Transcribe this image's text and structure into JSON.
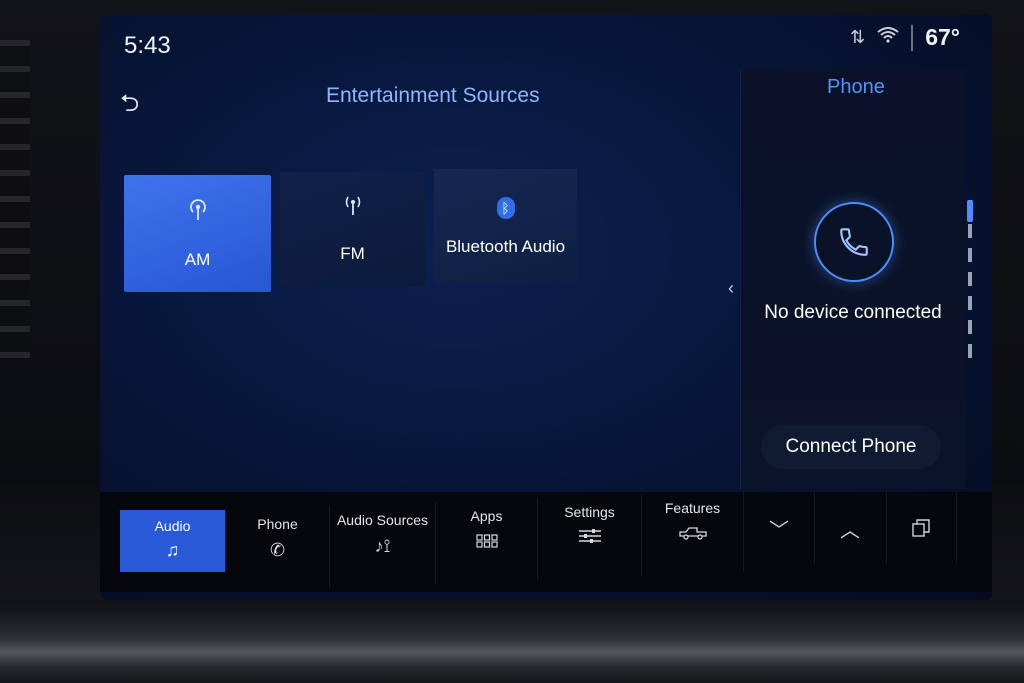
{
  "status": {
    "time": "5:43",
    "temperature": "67°",
    "signal_icon": "signal-arrows-icon",
    "wifi_icon": "wifi-icon"
  },
  "header": {
    "title": "Entertainment Sources",
    "back_icon": "back-arrow-icon"
  },
  "sources": [
    {
      "label": "AM",
      "icon": "am-antenna-icon",
      "active": true
    },
    {
      "label": "FM",
      "icon": "fm-antenna-icon",
      "active": false
    },
    {
      "label": "Bluetooth Audio",
      "icon": "bluetooth-icon",
      "active": false
    }
  ],
  "phone_panel": {
    "title": "Phone",
    "status": "No device connected",
    "connect_label": "Connect Phone"
  },
  "nav": {
    "items": [
      {
        "label": "Audio",
        "icon": "music-note-icon"
      },
      {
        "label": "Phone",
        "icon": "phone-icon"
      },
      {
        "label": "Audio Sources",
        "icon": "audio-sources-icon"
      },
      {
        "label": "Apps",
        "icon": "apps-grid-icon"
      },
      {
        "label": "Settings",
        "icon": "sliders-icon"
      },
      {
        "label": "Features",
        "icon": "truck-icon"
      }
    ]
  },
  "colors": {
    "accent": "#2a5ad8",
    "title_blue": "#8fb6ff",
    "phone_blue": "#4f95ff"
  }
}
